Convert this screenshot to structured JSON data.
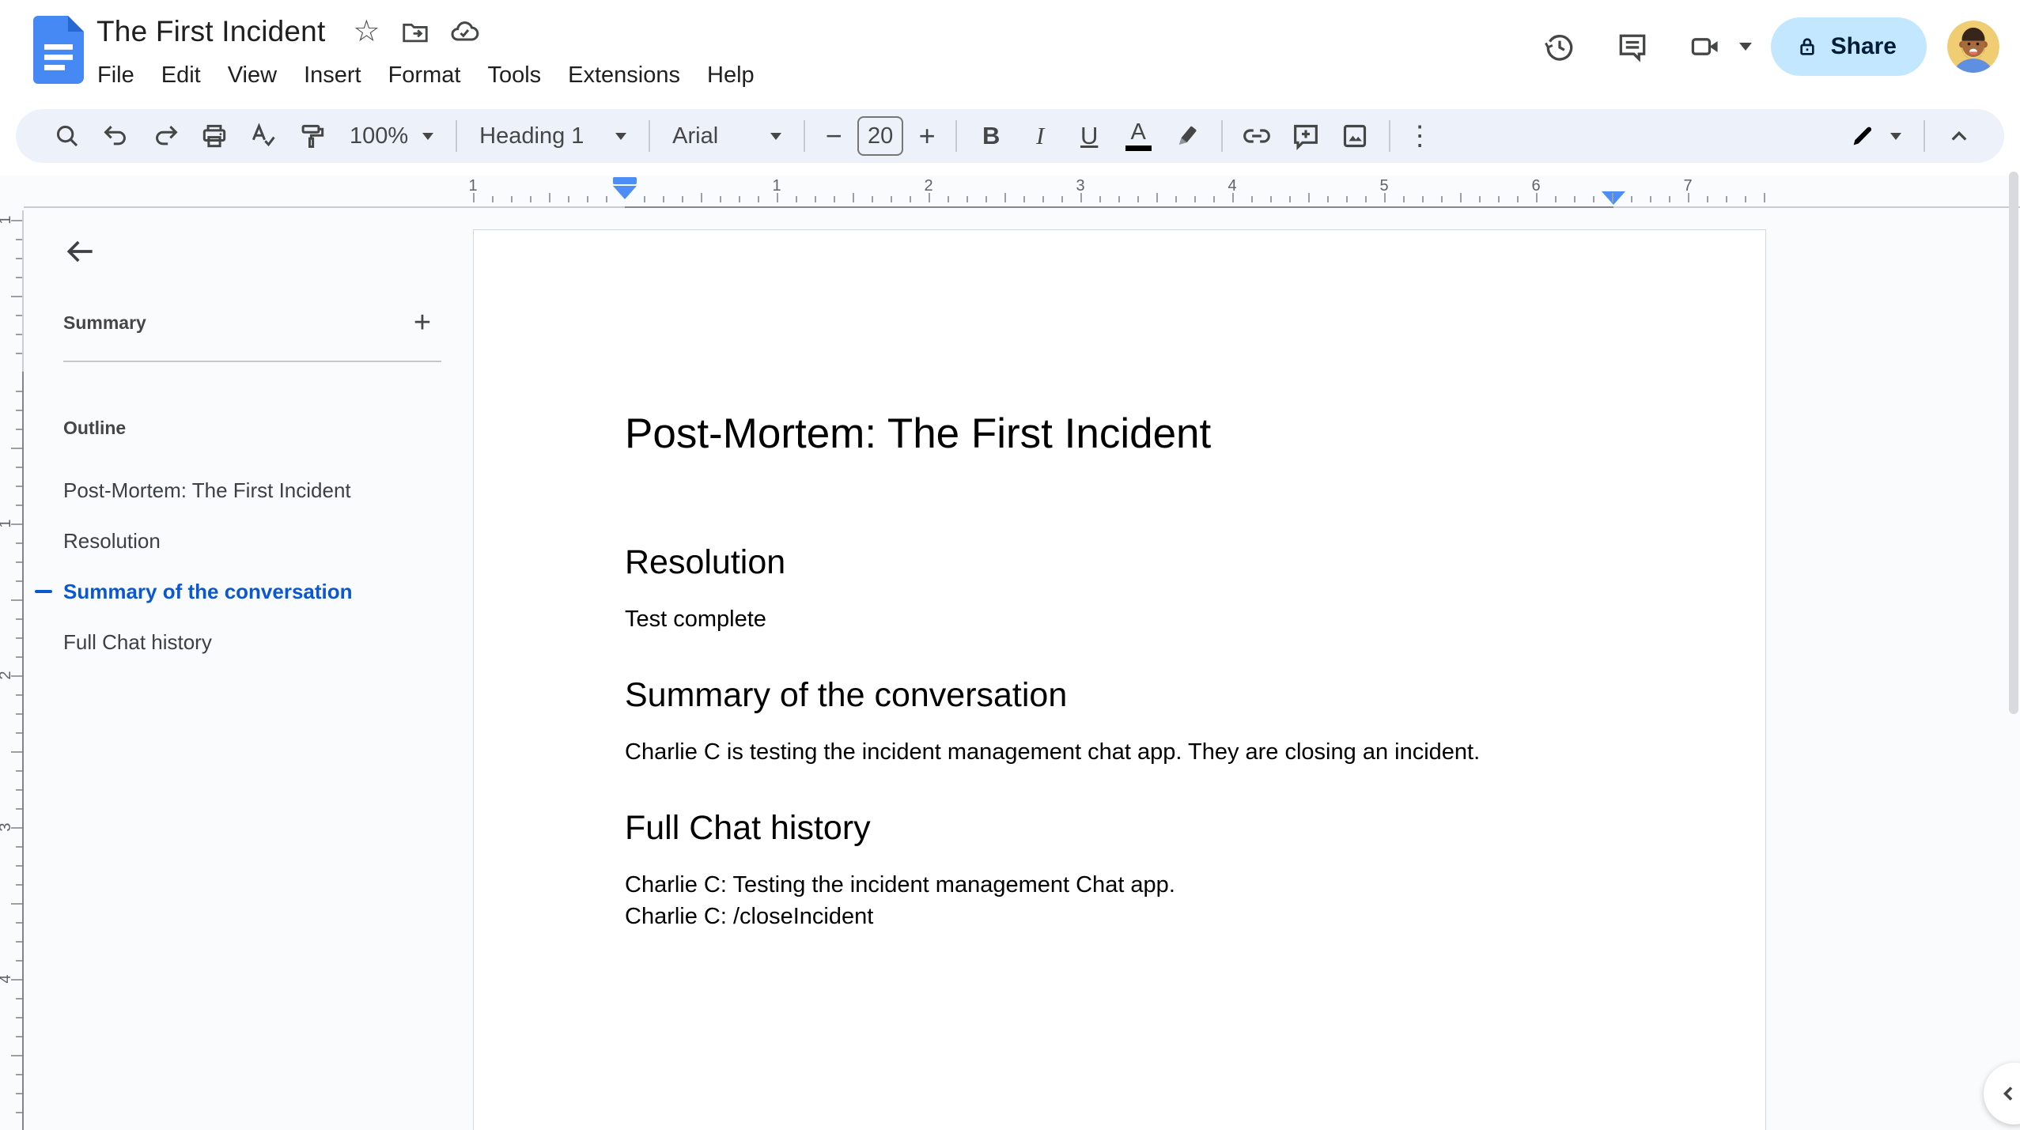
{
  "header": {
    "doc_title": "The First Incident",
    "menus": [
      "File",
      "Edit",
      "View",
      "Insert",
      "Format",
      "Tools",
      "Extensions",
      "Help"
    ],
    "share_label": "Share",
    "star_glyph": "☆"
  },
  "toolbar": {
    "zoom_value": "100%",
    "style_value": "Heading 1",
    "font_value": "Arial",
    "font_size_value": "20",
    "minus_glyph": "−",
    "plus_glyph": "+",
    "bold_glyph": "B",
    "italic_glyph": "I",
    "underline_glyph": "U",
    "text_color_glyph": "A",
    "more_glyph": "⋮"
  },
  "ruler": {
    "horizontal_numbers": [
      "1",
      "1",
      "2",
      "3",
      "4",
      "5",
      "6",
      "7"
    ],
    "vertical_numbers": [
      "1",
      "1",
      "2",
      "3",
      "4"
    ]
  },
  "sidebar": {
    "summary_label": "Summary",
    "add_summary_glyph": "+",
    "outline_label": "Outline",
    "outline_items": [
      {
        "label": "Post-Mortem: The First Incident",
        "active": false
      },
      {
        "label": "Resolution",
        "active": false
      },
      {
        "label": "Summary of the conversation",
        "active": true
      },
      {
        "label": "Full Chat history",
        "active": false
      }
    ]
  },
  "document": {
    "title": "Post-Mortem: The First Incident",
    "sections": [
      {
        "heading": "Resolution",
        "lines": [
          "Test complete"
        ]
      },
      {
        "heading": "Summary of the conversation",
        "lines": [
          "Charlie C is testing the incident management chat app. They are closing an incident."
        ]
      },
      {
        "heading": "Full Chat history",
        "lines": [
          "Charlie C: Testing the incident management Chat app.",
          "Charlie C: /closeIncident"
        ]
      }
    ]
  },
  "colors": {
    "docs_blue": "#4688f4",
    "docs_blue_fold": "#2767d2",
    "share_bg": "#c2e7ff",
    "share_text": "#001d35",
    "toolbar_bg": "#edf2fa",
    "canvas_bg": "#f9fbfd",
    "icon_grey": "#444746",
    "outline_active_blue": "#0b57d0",
    "ruler_marker_blue": "#4c8df6"
  }
}
